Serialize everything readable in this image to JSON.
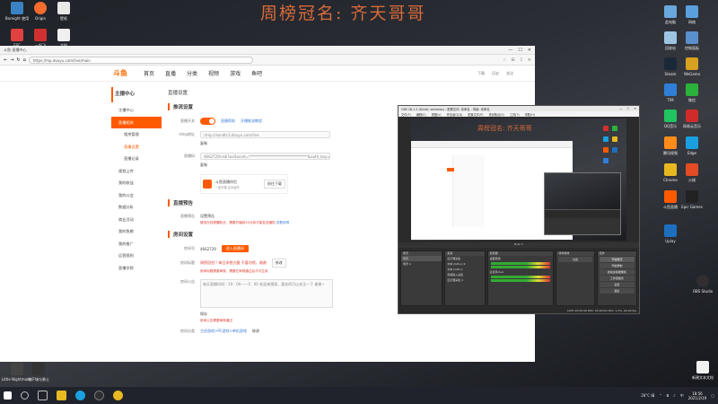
{
  "banner": "周榜冠名: 齐天哥哥",
  "desktop": {
    "left_icons": [
      {
        "label": "Boreight 使用",
        "color": "#3a82c4"
      },
      {
        "label": "Origin",
        "color": "#f56c2d"
      },
      {
        "label": "壁纸",
        "color": "#e8e8e8"
      },
      {
        "label": "ESC",
        "color": "#e04040"
      },
      {
        "label": "一起飞",
        "color": "#d03030"
      },
      {
        "label": "文档",
        "color": "#f0f0f0"
      }
    ],
    "bottom_icons": [
      {
        "label": "Little Nightmares",
        "color": "#444"
      },
      {
        "label": "地下城与勇士",
        "color": "#333"
      }
    ],
    "right_icons": [
      {
        "label": "此电脑",
        "color": "#6aa7dd"
      },
      {
        "label": "网络",
        "color": "#5aa0de"
      },
      {
        "label": "回收站",
        "color": "#9ec4e4"
      },
      {
        "label": "控制面板",
        "color": "#5a8fcd"
      },
      {
        "label": "Steam",
        "color": "#1b2838"
      },
      {
        "label": "WeGame",
        "color": "#d8a020"
      },
      {
        "label": "TIM",
        "color": "#2f7fd8"
      },
      {
        "label": "微信",
        "color": "#2ab23a"
      },
      {
        "label": "QQ音乐",
        "color": "#21c45f"
      },
      {
        "label": "网易云音乐",
        "color": "#d02b2b"
      },
      {
        "label": "腾讯视频",
        "color": "#ff8b1a"
      },
      {
        "label": "Edge",
        "color": "#1aa0e0"
      },
      {
        "label": "Chrome",
        "color": "#e8b820"
      },
      {
        "label": "火绒",
        "color": "#e34b24"
      },
      {
        "label": "斗鱼直播",
        "color": "#ff5a00"
      },
      {
        "label": "Epic Games",
        "color": "#222"
      },
      {
        "label": "Uplay",
        "color": "#1e6fbd"
      },
      {
        "label": "OBS Studio",
        "color": "#302e31"
      }
    ],
    "right_bottom_label": "新建文本文档"
  },
  "browser": {
    "title": "斗鱼-直播中心",
    "url": "https://mp.douyu.com/live/main",
    "site_nav": [
      "首页",
      "直播",
      "分类",
      "视频",
      "游戏",
      "鱼吧"
    ],
    "site_right": [
      "下载",
      "历史",
      "关注"
    ],
    "sidebar": {
      "header": "主播中心",
      "items": [
        {
          "label": "主播中心",
          "active": false,
          "sub": false
        },
        {
          "label": "直播相关",
          "active": true,
          "sub": false
        },
        {
          "label": "相关管理",
          "active": false,
          "sub": true
        },
        {
          "label": "直播设置",
          "active": false,
          "sub": true
        },
        {
          "label": "直播记录",
          "active": false,
          "sub": true
        },
        {
          "label": "视频上传",
          "active": false,
          "sub": false
        },
        {
          "label": "我的收益",
          "active": false,
          "sub": false
        },
        {
          "label": "我的公会",
          "active": false,
          "sub": false
        },
        {
          "label": "数据分析",
          "active": false,
          "sub": false
        },
        {
          "label": "商业活动",
          "active": false,
          "sub": false
        },
        {
          "label": "我的鱼粮",
          "active": false,
          "sub": false
        },
        {
          "label": "我的推广",
          "active": false,
          "sub": false
        },
        {
          "label": "运营规则",
          "active": false,
          "sub": false
        },
        {
          "label": "直播学院",
          "active": false,
          "sub": false
        }
      ]
    },
    "main": {
      "page_title": "直播设置",
      "push_section": "推流设置",
      "push_switch_label": "直播开关",
      "push_link1": "直播帮助",
      "push_link2": "开播推流教程",
      "rtmp_label": "rtmp地址",
      "rtmp_value": "rtmp://sendtc3.douyu.com/live",
      "copy": "复制",
      "code_label": "直播码",
      "code_value": "4662729rvsE?wsSecret=*********************************&auth_key=",
      "promo_title": "斗鱼直播伴侣",
      "promo_sub": "一键开播 高清画质",
      "promo_btn": "前往下载",
      "notice_section": "直播预告",
      "notice_label": "直播预告",
      "notice_value": "设置预告",
      "notice_warn": "微信在线提醒粉丝，需要开播前30分钟才能发送通知",
      "notice_link": "查看说明",
      "room_section": "房间设置",
      "room_id_label": "房间号",
      "room_id": "4662729",
      "room_btn": "进入直播间",
      "room_name_label": "房间标题",
      "room_name": "周榜冠名!! 每日求抱大腿 不喜勿喷，谢谢",
      "room_name_btn": "修改",
      "room_name_warn": "房间标题需要审核，需要在审核通过后才可生效",
      "room_notice_label": "房间公告",
      "room_notice_value": "每天直播时间：19：00——3：00 欢迎来围观，喜欢的可以关注一下 谢谢~",
      "save_btn": "保存",
      "room_notice_warn": "房间公告需要审核通过",
      "room_cat_label": "房间分类",
      "room_cat": "主机游戏>PC游戏>单机游戏",
      "room_cat_btn": "修改"
    }
  },
  "obs": {
    "title": "OBS 26.1.2 (64-bit, windows) - 配置文件: 未命名 - 场景: 未命名",
    "menu": [
      "文件(F)",
      "编辑(E)",
      "视图(V)",
      "停靠窗口(D)",
      "配置文件(P)",
      "场景集合(S)",
      "工具(T)",
      "帮助(H)"
    ],
    "scene_label": "场景",
    "scenes": [
      "场景",
      "场景 2"
    ],
    "sources_label": "来源",
    "sources": [
      "显示器采集",
      "文本 (GDI+) 2",
      "文本 (GDI+)",
      "音频输入采集",
      "显示器采集 2"
    ],
    "mixer_label": "混音器",
    "mixer": [
      "桌面音频",
      "麦克风/Aux"
    ],
    "transition_label": "转场特效",
    "transition": "淡出",
    "controls_label": "控件",
    "controls": [
      "开始推流",
      "开始录制",
      "启动虚拟摄像机",
      "工作室模式",
      "设置",
      "退出"
    ],
    "status": "LIVE: 00:00:00  REC: 00:00:00  CPU: 1.2%, 60.00 fps"
  },
  "taskbar": {
    "temp": "28°C 晴",
    "lang": "中",
    "time": "18:56",
    "date": "2021/2/19"
  }
}
